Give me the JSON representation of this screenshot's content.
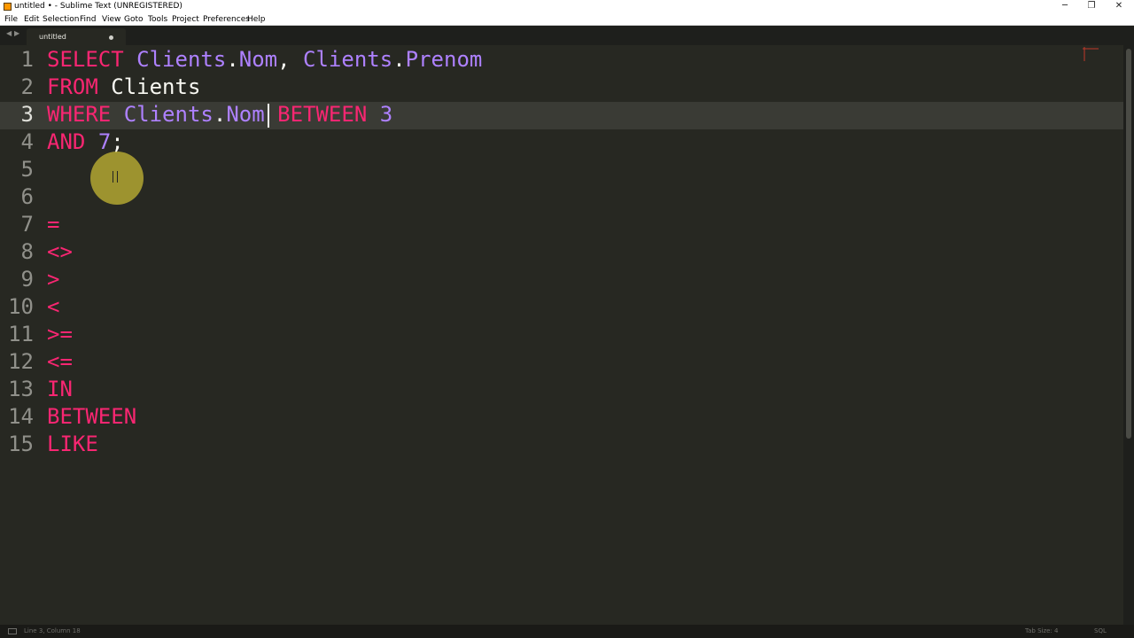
{
  "window": {
    "title": "untitled • - Sublime Text (UNREGISTERED)",
    "minimize_glyph": "─",
    "maximize_glyph": "❐",
    "close_glyph": "✕"
  },
  "menu": [
    "File",
    "Edit",
    "Selection",
    "Find",
    "View",
    "Goto",
    "Tools",
    "Project",
    "Preferences",
    "Help"
  ],
  "tabs": {
    "nav_left": "◀",
    "nav_right": "▶",
    "active_label": "untitled"
  },
  "editor": {
    "line_numbers": [
      "1",
      "2",
      "3",
      "4",
      "5",
      "6",
      "7",
      "8",
      "9",
      "10",
      "11",
      "12",
      "13",
      "14",
      "15"
    ],
    "current_line": 3,
    "lines": [
      [
        {
          "t": "SELECT",
          "c": "kw"
        },
        {
          "t": " ",
          "c": "wt"
        },
        {
          "t": "Clients",
          "c": "id"
        },
        {
          "t": ".",
          "c": "wt"
        },
        {
          "t": "Nom",
          "c": "id"
        },
        {
          "t": ", ",
          "c": "wt"
        },
        {
          "t": "Clients",
          "c": "id"
        },
        {
          "t": ".",
          "c": "wt"
        },
        {
          "t": "Prenom",
          "c": "id"
        }
      ],
      [
        {
          "t": "FROM",
          "c": "kw"
        },
        {
          "t": " ",
          "c": "wt"
        },
        {
          "t": "Clients",
          "c": "wt"
        }
      ],
      [
        {
          "t": "WHERE",
          "c": "kw"
        },
        {
          "t": " ",
          "c": "wt"
        },
        {
          "t": "Clients",
          "c": "id"
        },
        {
          "t": ".",
          "c": "wt"
        },
        {
          "t": "Nom",
          "c": "id"
        },
        {
          "t": " ",
          "c": "wt"
        },
        {
          "t": "BETWEEN",
          "c": "kw"
        },
        {
          "t": " ",
          "c": "wt"
        },
        {
          "t": "3",
          "c": "id"
        }
      ],
      [
        {
          "t": "AND",
          "c": "kw"
        },
        {
          "t": " ",
          "c": "wt"
        },
        {
          "t": "7",
          "c": "id"
        },
        {
          "t": ";",
          "c": "wt"
        }
      ],
      [],
      [],
      [
        {
          "t": "=",
          "c": "kw"
        }
      ],
      [
        {
          "t": "<>",
          "c": "kw"
        }
      ],
      [
        {
          "t": ">",
          "c": "kw"
        }
      ],
      [
        {
          "t": "<",
          "c": "kw"
        }
      ],
      [
        {
          "t": ">=",
          "c": "kw"
        }
      ],
      [
        {
          "t": "<=",
          "c": "kw"
        }
      ],
      [
        {
          "t": "IN",
          "c": "kw"
        }
      ],
      [
        {
          "t": "BETWEEN",
          "c": "kw"
        }
      ],
      [
        {
          "t": "LIKE",
          "c": "kw"
        }
      ]
    ]
  },
  "status": {
    "position": "Line 3, Column 18",
    "tab_size": "Tab Size: 4",
    "syntax": "SQL"
  },
  "colors": {
    "background": "#272822",
    "keyword": "#f92672",
    "identifier": "#ae81ff",
    "text": "#f8f8f2",
    "gutter": "#90908a"
  }
}
